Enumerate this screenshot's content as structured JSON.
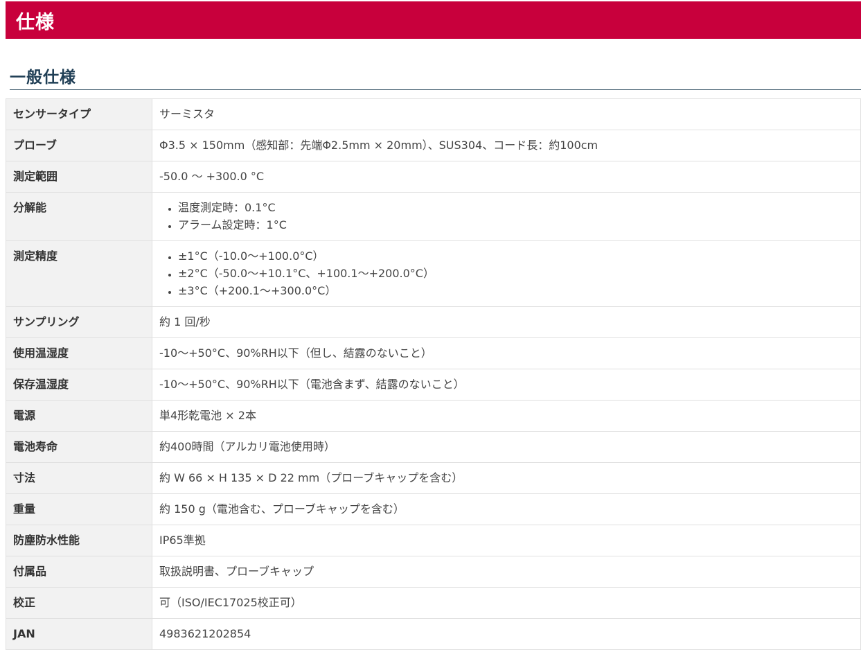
{
  "banner": {
    "title": "仕様"
  },
  "section": {
    "title": "一般仕様"
  },
  "rows": [
    {
      "label": "センサータイプ",
      "value": "サーミスタ"
    },
    {
      "label": "プローブ",
      "value": "Φ3.5 × 150mm（感知部：先端Φ2.5mm × 20mm）、SUS304、コード長：約100cm"
    },
    {
      "label": "測定範囲",
      "value": "-50.0 〜 +300.0 °C"
    },
    {
      "label": "分解能",
      "items": [
        "温度測定時：0.1°C",
        "アラーム設定時：1°C"
      ]
    },
    {
      "label": "測定精度",
      "items": [
        "±1°C（-10.0〜+100.0°C）",
        "±2°C（-50.0〜+10.1°C、+100.1〜+200.0°C）",
        "±3°C（+200.1〜+300.0°C）"
      ]
    },
    {
      "label": "サンプリング",
      "value": "約 1 回/秒"
    },
    {
      "label": "使用温湿度",
      "value": "-10〜+50°C、90%RH以下（但し、結露のないこと）"
    },
    {
      "label": "保存温湿度",
      "value": "-10〜+50°C、90%RH以下（電池含まず、結露のないこと）"
    },
    {
      "label": "電源",
      "value": "単4形乾電池 × 2本"
    },
    {
      "label": "電池寿命",
      "value": "約400時間（アルカリ電池使用時）"
    },
    {
      "label": "寸法",
      "value": "約 W 66 × H 135 × D 22 mm（プローブキャップを含む）"
    },
    {
      "label": "重量",
      "value": "約 150 g（電池含む、プローブキャップを含む）"
    },
    {
      "label": "防塵防水性能",
      "value": "IP65準拠"
    },
    {
      "label": "付属品",
      "value": "取扱説明書、プローブキャップ"
    },
    {
      "label": "校正",
      "value": "可（ISO/IEC17025校正可）"
    },
    {
      "label": "JAN",
      "value": "4983621202854"
    }
  ]
}
